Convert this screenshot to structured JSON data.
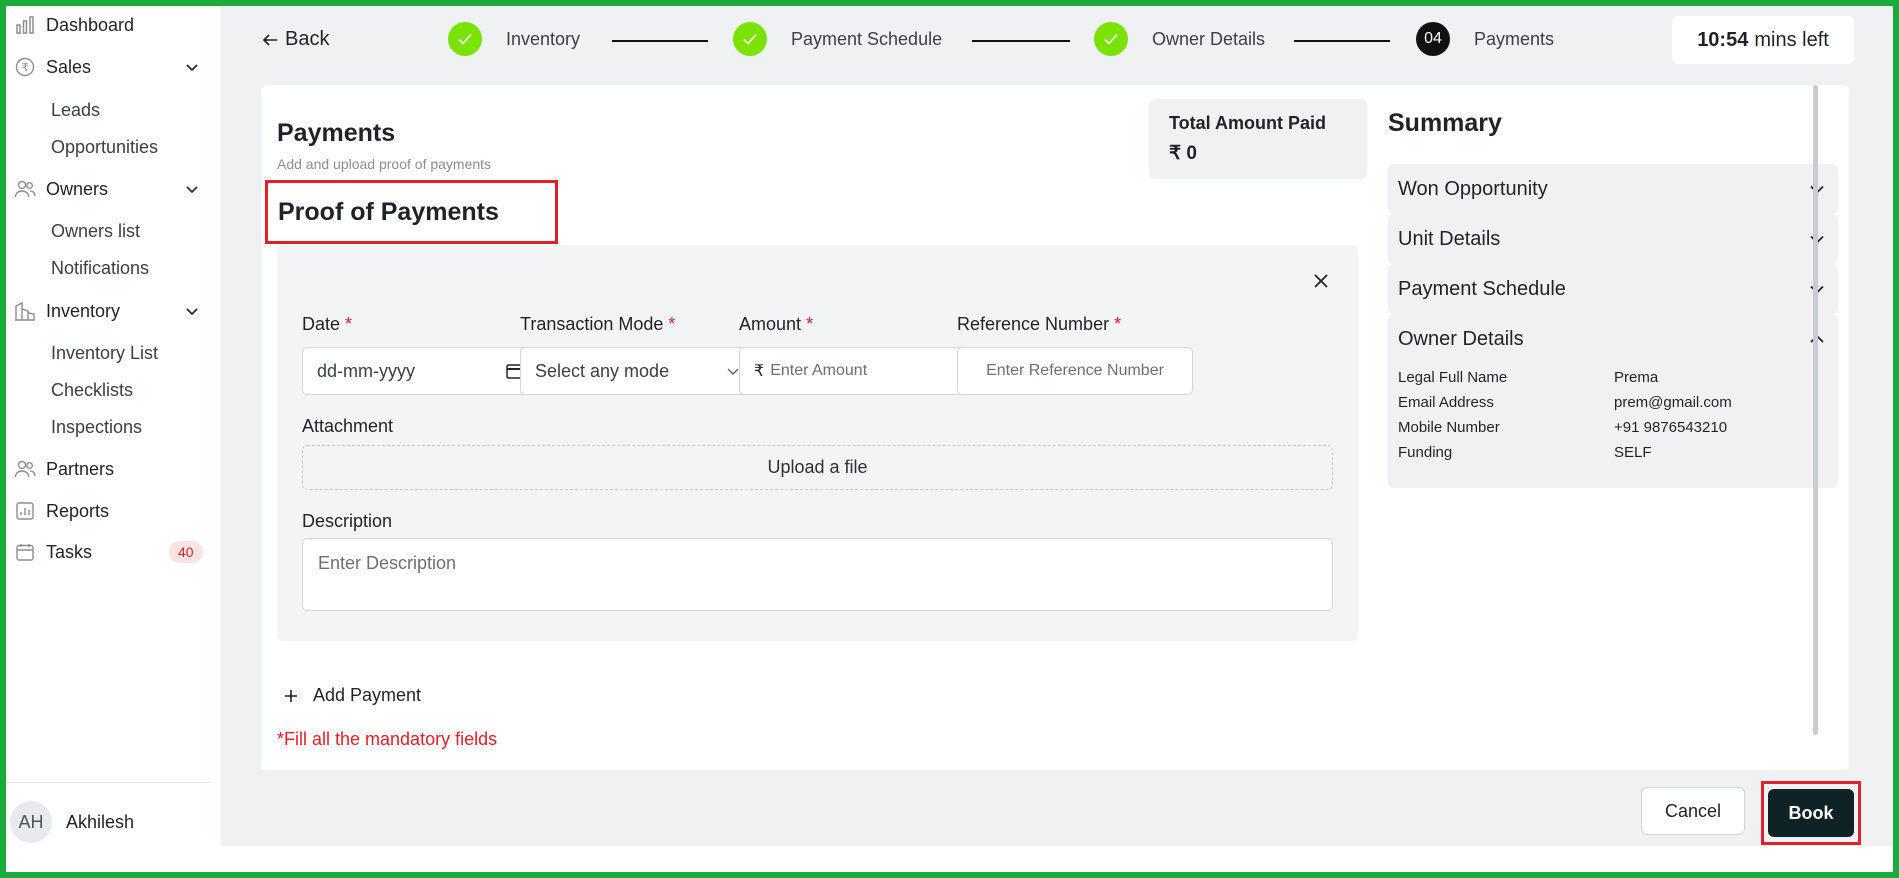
{
  "sidebar": {
    "dashboard": "Dashboard",
    "sales": "Sales",
    "leads": "Leads",
    "opportunities": "Opportunities",
    "owners": "Owners",
    "owners_list": "Owners list",
    "notifications": "Notifications",
    "inventory": "Inventory",
    "inventory_list": "Inventory List",
    "checklists": "Checklists",
    "inspections": "Inspections",
    "partners": "Partners",
    "reports": "Reports",
    "tasks": "Tasks",
    "tasks_badge": "40",
    "user_initials": "AH",
    "user_name": "Akhilesh"
  },
  "topbar": {
    "back_label": "Back",
    "steps": [
      {
        "label": "Inventory",
        "status": "done"
      },
      {
        "label": "Payment Schedule",
        "status": "done"
      },
      {
        "label": "Owner Details",
        "status": "done"
      },
      {
        "label": "Payments",
        "status": "current",
        "number": "04"
      }
    ],
    "timer_value": "10:54",
    "timer_suffix": "mins left"
  },
  "payments": {
    "title": "Payments",
    "subtitle": "Add and upload proof of payments",
    "total_label": "Total Amount Paid",
    "total_value": "₹ 0",
    "proof_title": "Proof of Payments",
    "fields": {
      "date_label": "Date",
      "date_value": "dd-mm-yyyy",
      "mode_label": "Transaction Mode",
      "mode_placeholder": "Select any mode",
      "amount_label": "Amount",
      "amount_placeholder": "Enter Amount",
      "ref_label": "Reference Number",
      "ref_placeholder": "Enter Reference Number",
      "required_mark": "*"
    },
    "attachment_label": "Attachment",
    "upload_label": "Upload a file",
    "description_label": "Description",
    "description_placeholder": "Enter Description",
    "add_payment_label": "Add Payment",
    "mandatory_msg": "*Fill all the mandatory fields"
  },
  "summary": {
    "title": "Summary",
    "sections": [
      "Won Opportunity",
      "Unit Details",
      "Payment Schedule"
    ],
    "owner_details": {
      "title": "Owner Details",
      "rows": [
        {
          "key": "Legal Full Name",
          "value": "Prema"
        },
        {
          "key": "Email Address",
          "value": "prem@gmail.com"
        },
        {
          "key": "Mobile Number",
          "value": "+91 9876543210"
        },
        {
          "key": "Funding",
          "value": "SELF"
        }
      ]
    }
  },
  "actions": {
    "cancel_label": "Cancel",
    "book_label": "Book"
  },
  "colors": {
    "step_done": "#7be300",
    "highlight": "#e0202a",
    "book_button": "#0f2325",
    "frame": "#1aab3c"
  }
}
